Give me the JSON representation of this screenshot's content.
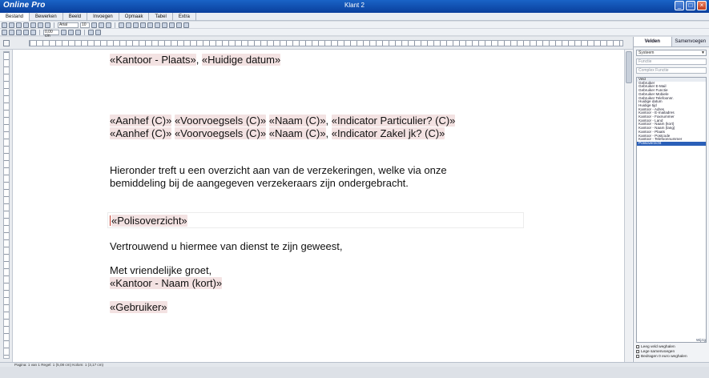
{
  "window": {
    "app_name": "Online Pro",
    "title": "Klant 2",
    "buttons": [
      "_",
      "□",
      "×"
    ]
  },
  "menu": [
    "Bestand",
    "Bewerken",
    "Beeld",
    "Invoegen",
    "Opmaak",
    "Tabel",
    "Extra"
  ],
  "toolbar": {
    "font": "Arial",
    "size": "10",
    "indent": "0,00 cm"
  },
  "document": {
    "plaats_field": "«Kantoor - Plaats»",
    "plaats_sep": ", ",
    "datum_field": "«Huidige datum»",
    "aanhef1": {
      "aanhef": "«Aanhef (C)»",
      "voorv": "«Voorvoegsels (C)»",
      "naam": "«Naam (C)»",
      "sep": ", ",
      "ind": "«Indicator Particulier? (C)»"
    },
    "aanhef2": {
      "aanhef": "«Aanhef (C)»",
      "voorv": "«Voorvoegsels (C)»",
      "naam": "«Naam (C)»",
      "sep": ", ",
      "ind": "«Indicator Zakel jk? (C)»"
    },
    "body_line1": "Hieronder treft u een overzicht aan van de verzekeringen, welke via onze",
    "body_line2": "bemiddeling bij de aangegeven verzekeraars zijn ondergebracht.",
    "polis_field": "«Polisoverzicht»",
    "vertrouwend": "Vertrouwend u hiermee van dienst te zijn geweest,",
    "groet": "Met vriendelijke groet,",
    "kantoor_naam": "«Kantoor - Naam (kort)»",
    "gebruiker": "«Gebruiker»"
  },
  "right_panel": {
    "tabs": [
      "Velden",
      "Samenvoegen"
    ],
    "category": "Systeem",
    "input1_placeholder": "Functie",
    "input2_placeholder": "Complex Functie",
    "list_header": "Veld",
    "list_items": [
      "Gebruiker",
      "Gebruiker E-Mail",
      "Gebruiker Functie",
      "Gebruiker Mobiele",
      "Gebruiker Telefoonnr.",
      "Huidige datum",
      "Huidige tijd",
      "Kantoor - Adres",
      "Kantoor - E-mailadres",
      "Kantoor - Faxnummer",
      "Kantoor - Land",
      "Kantoor - Naam (kort)",
      "Kantoor - Naam (lang)",
      "Kantoor - Plaats",
      "Kantoor - Postcode",
      "Kantoor - Telefoonnummer",
      "Polisoverzicht"
    ],
    "selected_item": "Polisoverzicht",
    "wijzig": "Wijzig",
    "checks": [
      "Leeg veld weghalen",
      "Lege samenvoegen",
      "Bedragen 0 euro weghalen"
    ]
  },
  "status": "Pagina: 1 van 1   Regel: 1 (5,08 cm)   Kolom: 1 (3,17 cm)"
}
